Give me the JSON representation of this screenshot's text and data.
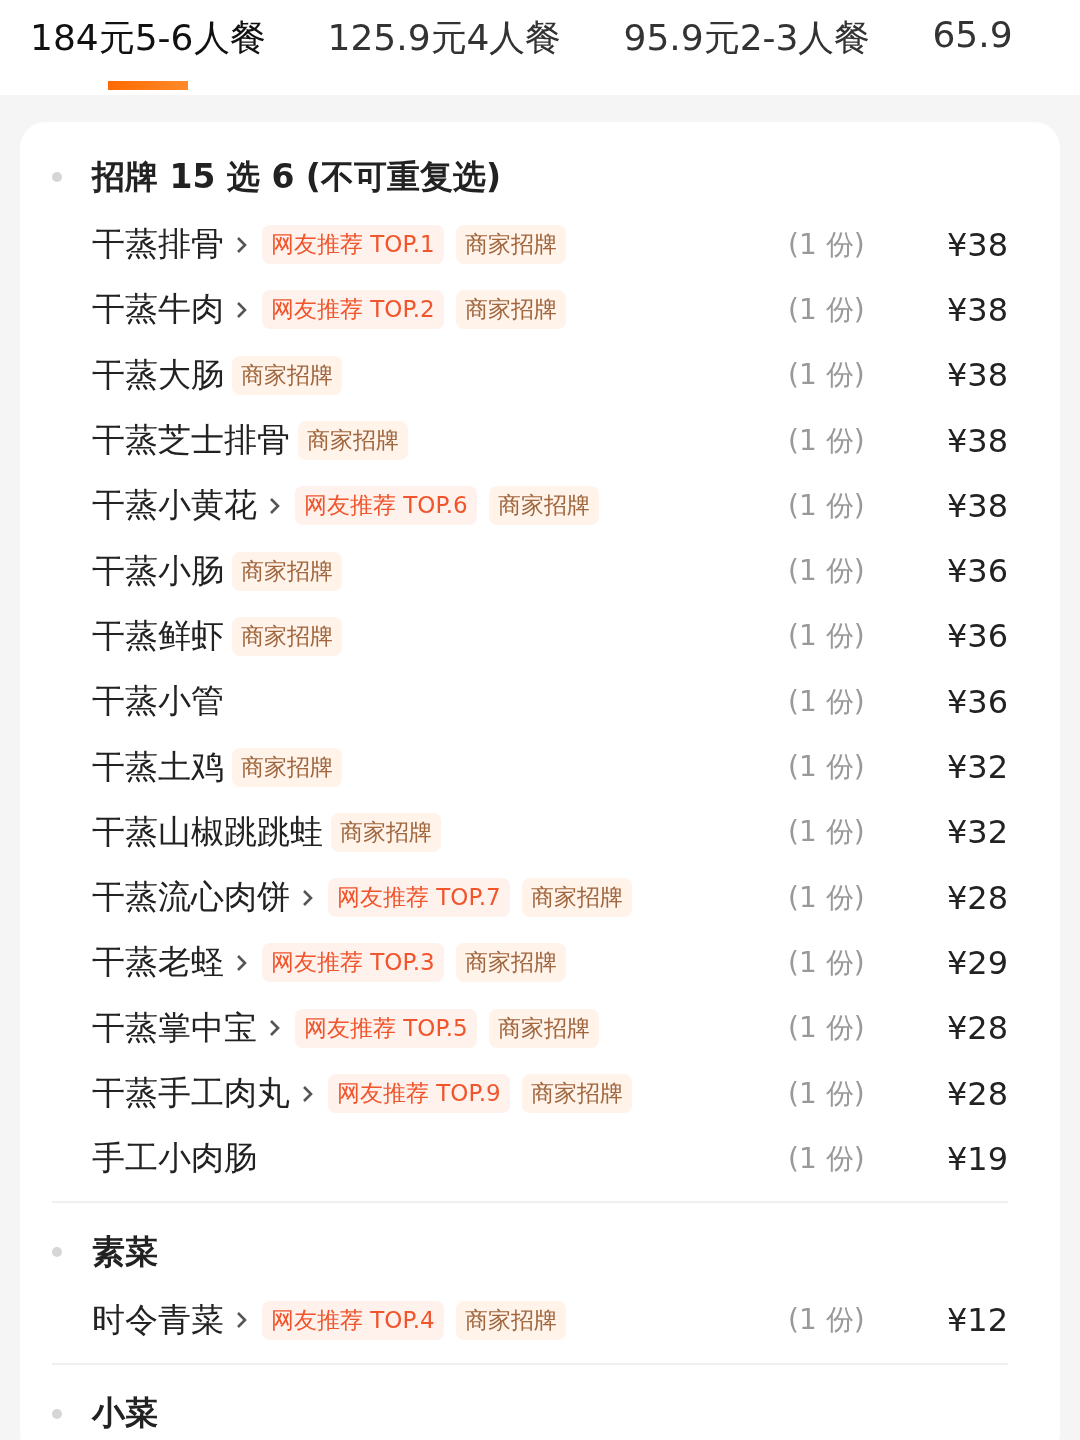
{
  "tabs": [
    {
      "label": "184元5-6人餐",
      "selected": true
    },
    {
      "label": "125.9元4人餐",
      "selected": false
    },
    {
      "label": "95.9元2-3人餐",
      "selected": false
    },
    {
      "label": "65.9",
      "selected": false
    }
  ],
  "sections": [
    {
      "title": "招牌 15 选 6 (不可重复选)",
      "items": [
        {
          "name": "干蒸排骨",
          "chevron": true,
          "tags": [
            {
              "kind": "rank",
              "text": "网友推荐 TOP.1"
            },
            {
              "kind": "merchant",
              "text": "商家招牌"
            }
          ],
          "qty": "(1 份)",
          "price": "¥38"
        },
        {
          "name": "干蒸牛肉",
          "chevron": true,
          "tags": [
            {
              "kind": "rank",
              "text": "网友推荐 TOP.2"
            },
            {
              "kind": "merchant",
              "text": "商家招牌"
            }
          ],
          "qty": "(1 份)",
          "price": "¥38"
        },
        {
          "name": "干蒸大肠",
          "chevron": false,
          "tags": [
            {
              "kind": "merchant",
              "text": "商家招牌"
            }
          ],
          "qty": "(1 份)",
          "price": "¥38"
        },
        {
          "name": "干蒸芝士排骨",
          "chevron": false,
          "tags": [
            {
              "kind": "merchant",
              "text": "商家招牌"
            }
          ],
          "qty": "(1 份)",
          "price": "¥38"
        },
        {
          "name": "干蒸小黄花",
          "chevron": true,
          "tags": [
            {
              "kind": "rank",
              "text": "网友推荐 TOP.6"
            },
            {
              "kind": "merchant",
              "text": "商家招牌"
            }
          ],
          "qty": "(1 份)",
          "price": "¥38"
        },
        {
          "name": "干蒸小肠",
          "chevron": false,
          "tags": [
            {
              "kind": "merchant",
              "text": "商家招牌"
            }
          ],
          "qty": "(1 份)",
          "price": "¥36"
        },
        {
          "name": "干蒸鲜虾",
          "chevron": false,
          "tags": [
            {
              "kind": "merchant",
              "text": "商家招牌"
            }
          ],
          "qty": "(1 份)",
          "price": "¥36"
        },
        {
          "name": "干蒸小管",
          "chevron": false,
          "qty": "(1 份)",
          "price": "¥36"
        },
        {
          "name": "干蒸土鸡",
          "chevron": false,
          "tags": [
            {
              "kind": "merchant",
              "text": "商家招牌"
            }
          ],
          "qty": "(1 份)",
          "price": "¥32"
        },
        {
          "name": "干蒸山椒跳跳蛙",
          "chevron": false,
          "tags": [
            {
              "kind": "merchant",
              "text": "商家招牌"
            }
          ],
          "qty": "(1 份)",
          "price": "¥32"
        },
        {
          "name": "干蒸流心肉饼",
          "chevron": true,
          "tags": [
            {
              "kind": "rank",
              "text": "网友推荐 TOP.7"
            },
            {
              "kind": "merchant",
              "text": "商家招牌"
            }
          ],
          "qty": "(1 份)",
          "price": "¥28"
        },
        {
          "name": "干蒸老蛏",
          "chevron": true,
          "tags": [
            {
              "kind": "rank",
              "text": "网友推荐 TOP.3"
            },
            {
              "kind": "merchant",
              "text": "商家招牌"
            }
          ],
          "qty": "(1 份)",
          "price": "¥29"
        },
        {
          "name": "干蒸掌中宝",
          "chevron": true,
          "tags": [
            {
              "kind": "rank",
              "text": "网友推荐 TOP.5"
            },
            {
              "kind": "merchant",
              "text": "商家招牌"
            }
          ],
          "qty": "(1 份)",
          "price": "¥28"
        },
        {
          "name": "干蒸手工肉丸",
          "chevron": true,
          "tags": [
            {
              "kind": "rank",
              "text": "网友推荐 TOP.9"
            },
            {
              "kind": "merchant",
              "text": "商家招牌"
            }
          ],
          "qty": "(1 份)",
          "price": "¥28"
        },
        {
          "name": "手工小肉肠",
          "chevron": false,
          "qty": "(1 份)",
          "price": "¥19"
        }
      ]
    },
    {
      "title": "素菜",
      "items": [
        {
          "name": "时令青菜",
          "chevron": true,
          "tags": [
            {
              "kind": "rank",
              "text": "网友推荐 TOP.4"
            },
            {
              "kind": "merchant",
              "text": "商家招牌"
            }
          ],
          "qty": "(1 份)",
          "price": "¥12"
        }
      ]
    },
    {
      "title": "小菜"
    }
  ]
}
